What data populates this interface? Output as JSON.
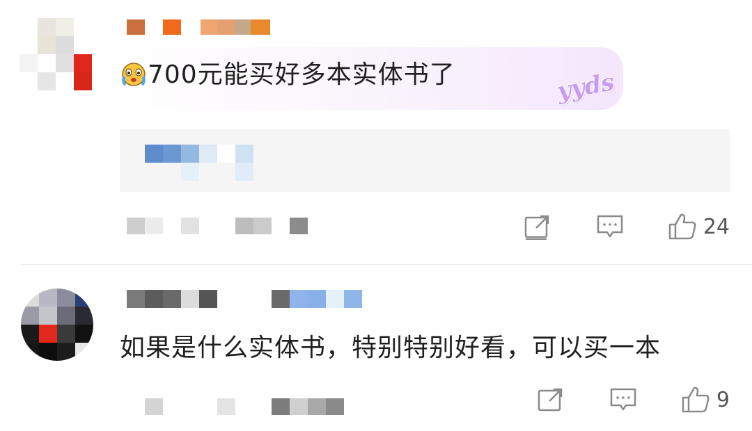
{
  "comments": [
    {
      "text": "700元能买好多本实体书了",
      "emoji": "crying-face-emoji",
      "sticker": "yyds",
      "likes": "24"
    },
    {
      "text": "如果是什么实体书，特别特别好看，可以买一本",
      "likes": "9"
    }
  ],
  "icons": {
    "share": "share-icon",
    "comment": "comment-icon",
    "like": "thumbs-up-icon"
  },
  "colors": {
    "bubble_accent": "#f4e6fb",
    "sticker": "#c79cf0",
    "reply_bg": "#f5f5f5"
  }
}
